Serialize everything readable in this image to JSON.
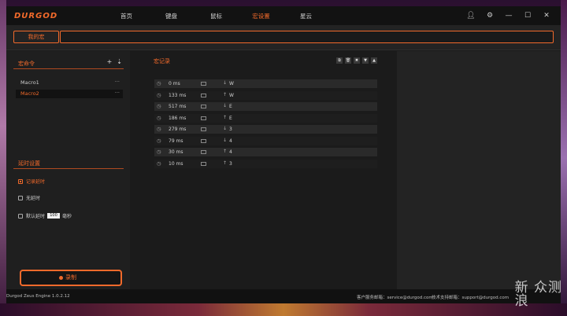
{
  "app": {
    "logo": "DURGOD"
  },
  "nav": [
    {
      "label": "首页"
    },
    {
      "label": "键盘"
    },
    {
      "label": "鼠标"
    },
    {
      "label": "宏设置"
    },
    {
      "label": "星云"
    }
  ],
  "window_controls": [
    "user-icon",
    "gear-icon",
    "minimize-icon",
    "maximize-icon",
    "close-icon"
  ],
  "macrobar": {
    "tab_label": "我的宏",
    "name_value": ""
  },
  "macro_panel": {
    "title": "宏命令",
    "items": [
      {
        "label": "Macro1",
        "more": "···"
      },
      {
        "label": "Macro2",
        "more": "···"
      }
    ]
  },
  "delay_settings": {
    "title": "延时设置",
    "options": [
      {
        "label": "记录延时"
      },
      {
        "label": "无延时"
      },
      {
        "label": "默认延时",
        "value": "100",
        "unit": "毫秒"
      }
    ]
  },
  "record_button": {
    "label": "录制"
  },
  "record_panel": {
    "title": "宏记录",
    "rows": [
      {
        "delay": "0 ms",
        "dir": "↓",
        "key": "W"
      },
      {
        "delay": "133 ms",
        "dir": "↑",
        "key": "W"
      },
      {
        "delay": "517 ms",
        "dir": "↓",
        "key": "E"
      },
      {
        "delay": "186 ms",
        "dir": "↑",
        "key": "E"
      },
      {
        "delay": "279 ms",
        "dir": "↓",
        "key": "3"
      },
      {
        "delay": "79 ms",
        "dir": "↓",
        "key": "4"
      },
      {
        "delay": "30 ms",
        "dir": "↑",
        "key": "4"
      },
      {
        "delay": "10 ms",
        "dir": "↑",
        "key": "3"
      }
    ]
  },
  "footer": {
    "version": "Durgod Zeus Engine 1.0.2.12",
    "service": "客户服务邮箱：service@durgod.com",
    "support": "技术支持邮箱：support@durgod.com"
  },
  "watermark": "新 众测\n浪"
}
